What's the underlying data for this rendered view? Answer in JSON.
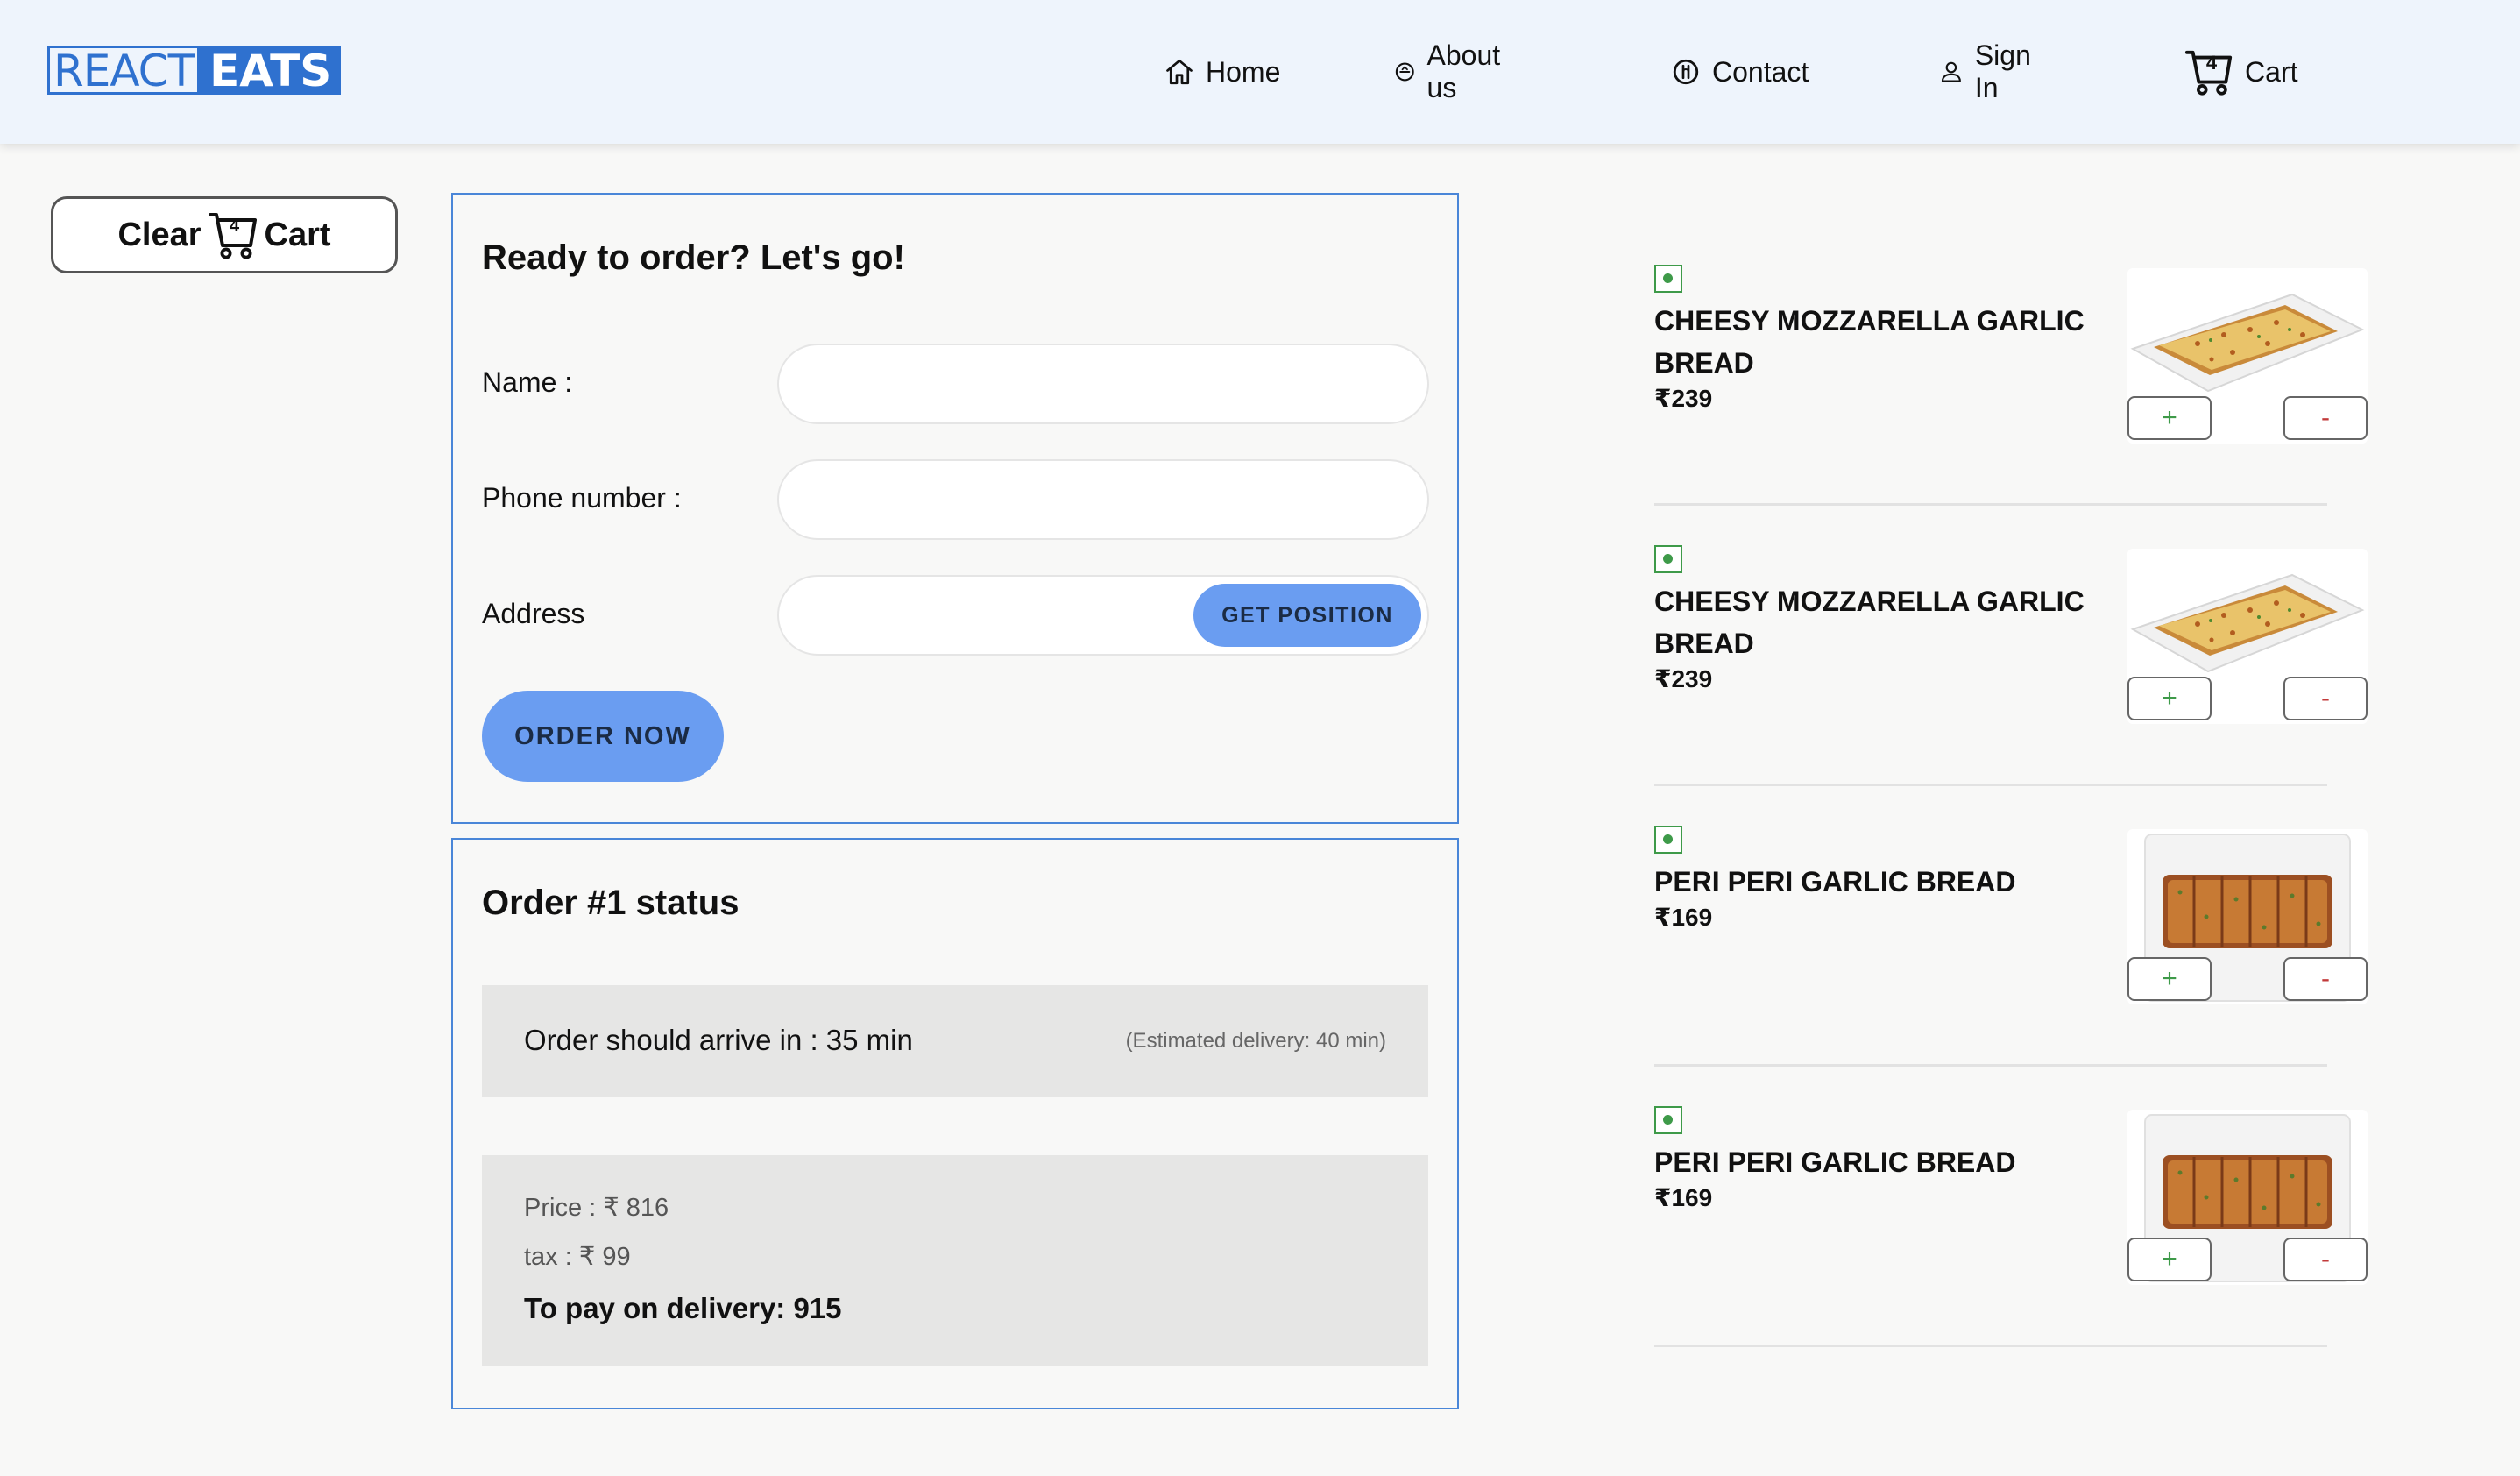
{
  "brand": {
    "part1": "REACT",
    "part2": "EATS",
    "color": "#2f71cf"
  },
  "nav": {
    "home": "Home",
    "about": "About us",
    "contact": "Contact",
    "signin": "Sign In",
    "cart": "Cart",
    "cart_count": "4"
  },
  "clear_cart": {
    "left": "Clear",
    "right": "Cart",
    "count": "4"
  },
  "order_form": {
    "title": "Ready to order? Let's go!",
    "name_label": "Name :",
    "name_value": "",
    "phone_label": "Phone number :",
    "phone_value": "",
    "address_label": "Address",
    "address_value": "",
    "get_position": "GET POSITION",
    "order_now": "ORDER NOW"
  },
  "status": {
    "title": "Order #1 status",
    "eta": "Order should arrive in : 35 min",
    "estimated": "(Estimated delivery: 40 min)",
    "price": "Price : ₹ 816",
    "tax": "tax : ₹ 99",
    "to_pay": "To pay on delivery: 915"
  },
  "menu": {
    "items": [
      {
        "name": "CHEESY MOZZARELLA GARLIC BREAD",
        "price": "₹239",
        "image": "cheesy-garlic-bread",
        "veg": true,
        "plus": "+",
        "minus": "-"
      },
      {
        "name": "CHEESY MOZZARELLA GARLIC BREAD",
        "price": "₹239",
        "image": "cheesy-garlic-bread",
        "veg": true,
        "plus": "+",
        "minus": "-"
      },
      {
        "name": "PERI PERI GARLIC BREAD",
        "price": "₹169",
        "image": "peri-peri-garlic-bread",
        "veg": true,
        "plus": "+",
        "minus": "-"
      },
      {
        "name": "PERI PERI GARLIC BREAD",
        "price": "₹169",
        "image": "peri-peri-garlic-bread",
        "veg": true,
        "plus": "+",
        "minus": "-"
      }
    ]
  },
  "colors": {
    "accent": "#6a9df1",
    "panel_border": "#4a86d8",
    "veg_green": "#3e9a49",
    "minus_red": "#c23a3a"
  }
}
